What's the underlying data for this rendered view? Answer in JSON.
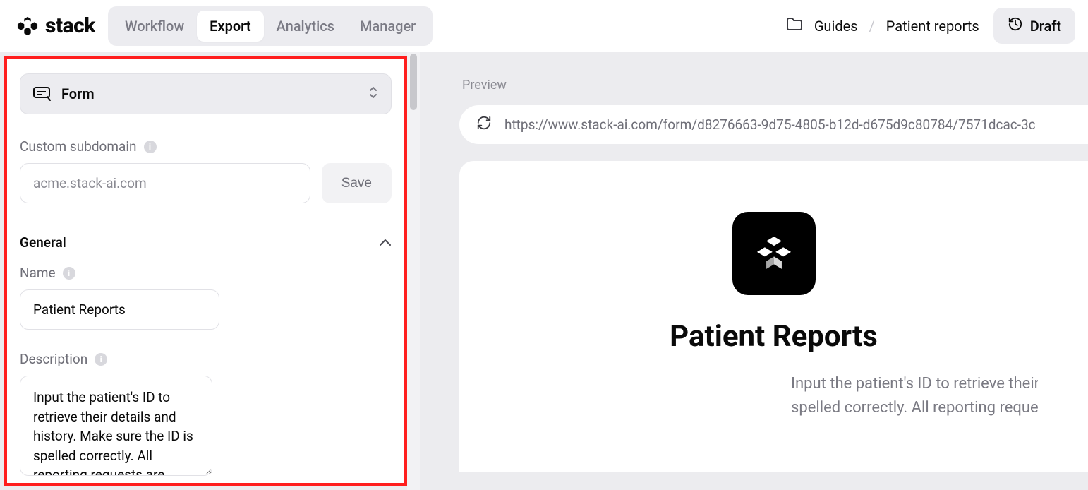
{
  "header": {
    "logo_text": "stack",
    "tabs": {
      "workflow": "Workflow",
      "export": "Export",
      "analytics": "Analytics",
      "manager": "Manager"
    },
    "active_tab": "export",
    "breadcrumb": {
      "guides": "Guides",
      "current": "Patient reports"
    },
    "draft_label": "Draft"
  },
  "sidebar": {
    "form_selector_label": "Form",
    "subdomain": {
      "label": "Custom subdomain",
      "value": "acme.stack-ai.com",
      "save_label": "Save"
    },
    "general": {
      "heading": "General",
      "name_label": "Name",
      "name_value": "Patient Reports",
      "description_label": "Description",
      "description_value": "Input the patient's ID to retrieve their details and history. Make sure the ID is spelled correctly. All reporting requests are saved."
    }
  },
  "preview": {
    "label": "Preview",
    "url": "https://www.stack-ai.com/form/d8276663-9d75-4805-b12d-d675d9c80784/7571dcac-3c",
    "title": "Patient Reports",
    "description_line1": "Input the patient's ID to retrieve their",
    "description_line2": "spelled correctly. All reporting reque"
  }
}
